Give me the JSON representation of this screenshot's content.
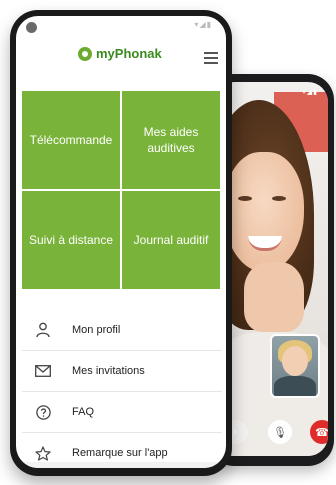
{
  "app": {
    "name": "myPhonak",
    "accent_color": "#7ab33a"
  },
  "tiles": [
    {
      "label": "Télécommande"
    },
    {
      "label": "Mes aides auditives"
    },
    {
      "label": "Suivi à distance"
    },
    {
      "label": "Journal auditif"
    }
  ],
  "menu": [
    {
      "label": "Mon profil",
      "icon": "person-icon"
    },
    {
      "label": "Mes invitations",
      "icon": "envelope-icon"
    },
    {
      "label": "FAQ",
      "icon": "question-icon"
    },
    {
      "label": "Remarque sur l'app",
      "icon": "star-icon"
    }
  ],
  "video_call": {
    "controls": [
      {
        "icon": "camera-icon"
      },
      {
        "icon": "microphone-icon"
      },
      {
        "icon": "end-call-icon",
        "color": "#e02b2b"
      }
    ]
  }
}
